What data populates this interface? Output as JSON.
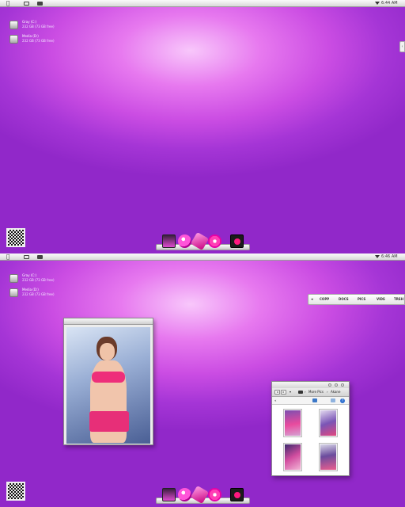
{
  "screens": [
    {
      "menubar": {
        "apple_glyph": "",
        "clock": "6:44 AM"
      },
      "drives": [
        {
          "name": "Gray (C:)",
          "size": "232 GB (73 GB free)"
        },
        {
          "name": "Media (D:)",
          "size": "232 GB (73 GB free)"
        }
      ],
      "edge_tab": "‹"
    },
    {
      "menubar": {
        "apple_glyph": "",
        "clock": "6:46 AM"
      },
      "drives": [
        {
          "name": "Gray (C:)",
          "size": "232 GB (73 GB free)"
        },
        {
          "name": "Media (D:)",
          "size": "232 GB (73 GB free)"
        }
      ],
      "tabbar": {
        "arrow": "◂",
        "tabs": [
          "COPP",
          "DOCS",
          "PICS",
          "VIDS",
          "TRSH"
        ]
      },
      "finder": {
        "back": "◂",
        "forward": "▸",
        "menu_arrow": "▾",
        "path": [
          "More Pics",
          "Akane"
        ],
        "separator": "›",
        "left_arrows": "«",
        "help": "?"
      }
    }
  ],
  "dock": {
    "icons": [
      "media-player-icon",
      "itunes-icon",
      "finder-rocket-icon",
      "dvd-icon",
      "photobooth-icon"
    ]
  },
  "colors": {
    "wallpaper_center": "#f8c7fb",
    "wallpaper_edge": "#9128c9",
    "accent_pink": "#ee2e7a"
  }
}
